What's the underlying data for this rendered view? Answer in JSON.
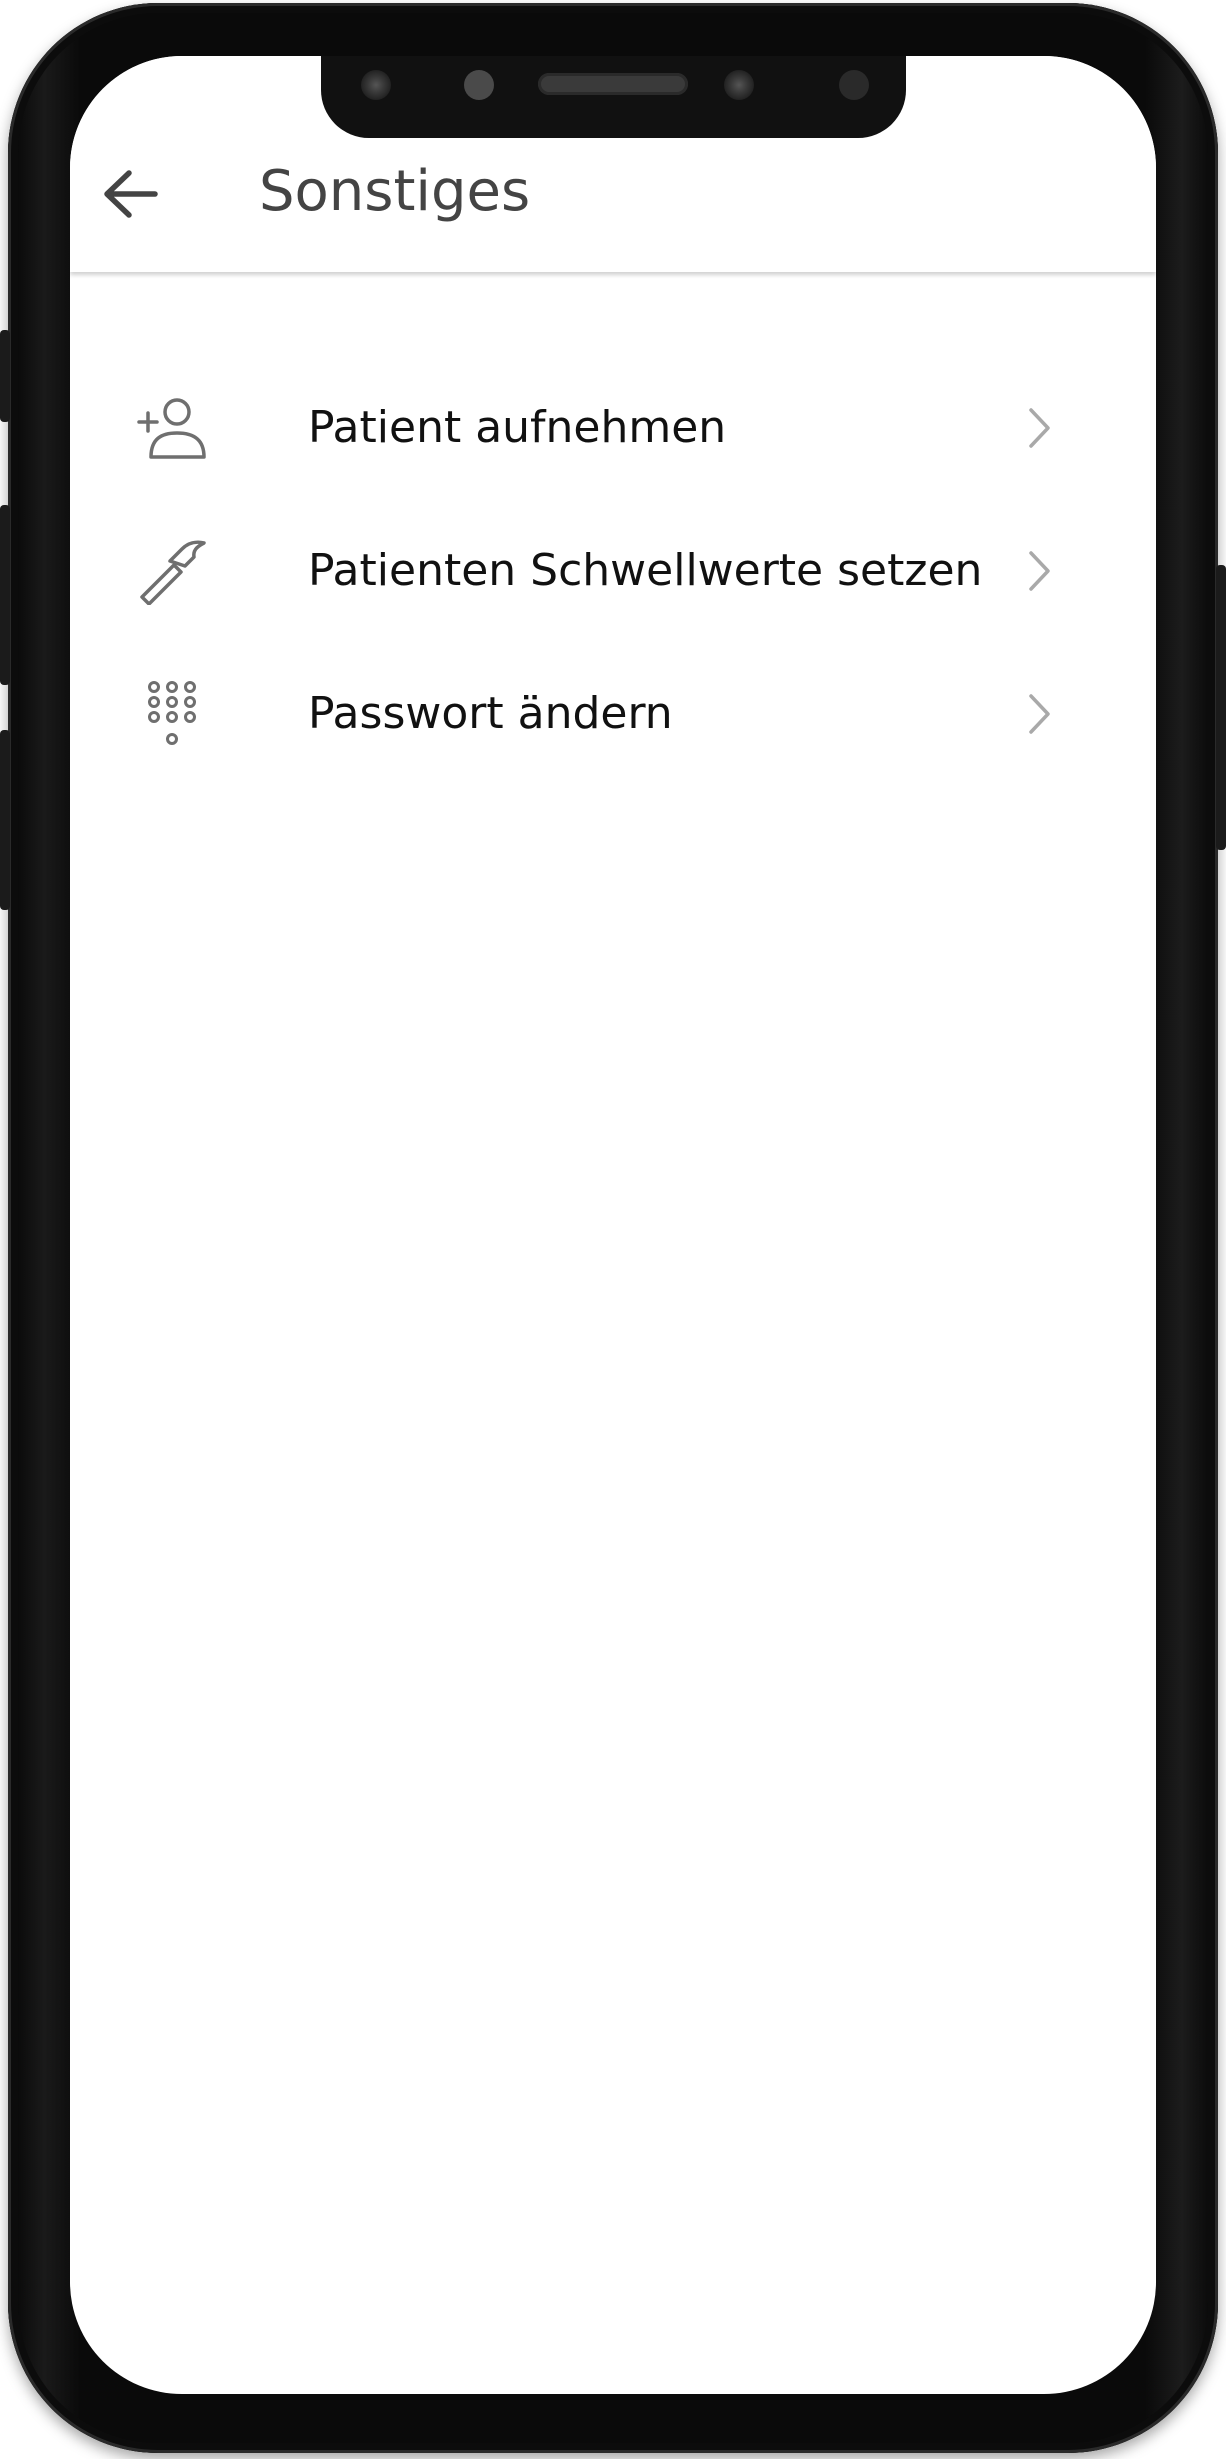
{
  "app_bar": {
    "title": "Sonstiges",
    "back_icon": "arrow-left-icon"
  },
  "menu": {
    "items": [
      {
        "label": "Patient aufnehmen",
        "icon": "person-add-icon"
      },
      {
        "label": "Patienten Schwellwerte setzen",
        "icon": "hammer-icon"
      },
      {
        "label": "Passwort ändern",
        "icon": "keypad-icon"
      }
    ],
    "chevron_icon": "chevron-right-icon"
  },
  "colors": {
    "title": "#444444",
    "label": "#111111",
    "icon": "#6f6f6f",
    "chevron": "#a9a9a9",
    "frame": "#0a0a0a"
  }
}
